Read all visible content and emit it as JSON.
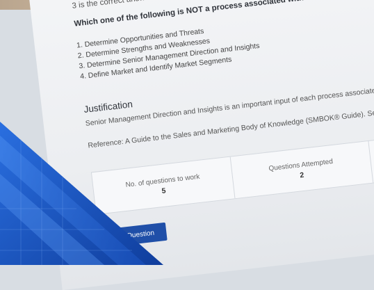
{
  "quiz": {
    "answer_line": "3 is the correct answ...",
    "question": "Which one of the following is NOT a process associated with Market Opportunity ...",
    "options": [
      "1. Determine Opportunities and Threats",
      "2. Determine Strengths and Weaknesses",
      "3. Determine Senior Management Direction and Insights",
      "4. Define Market and Identify Market Segments"
    ]
  },
  "justification": {
    "title": "Justification",
    "text": "Senior Management Direction and Insights is an important input of each process associate",
    "reference": "Reference: A Guide to the Sales and Marketing Body of Knowledge (SMBOK® Guide). Se"
  },
  "stats": {
    "to_work_label": "No. of questions to work",
    "to_work_value": "5",
    "attempted_label": "Questions Attempted",
    "attempted_value": "2"
  },
  "actions": {
    "next_label": "Next Question"
  },
  "colors": {
    "accent_button": "#1f4fa8",
    "overlay_blue": "#1d5bd0"
  }
}
